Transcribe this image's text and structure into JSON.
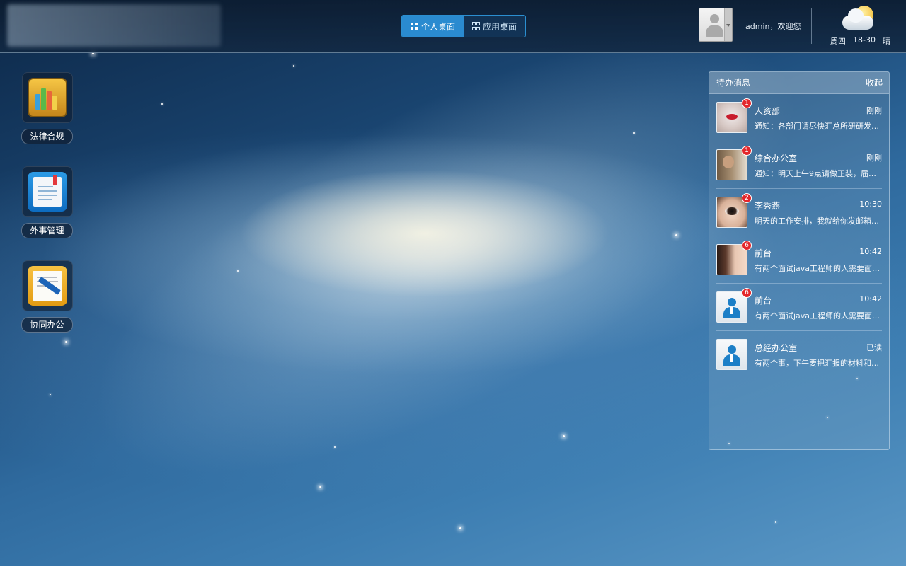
{
  "topbar": {
    "desk_switch": [
      {
        "label": "个人桌面",
        "active": true,
        "icon": "grid-filled-icon"
      },
      {
        "label": "应用桌面",
        "active": false,
        "icon": "grid-outline-icon"
      }
    ],
    "welcome_text": "admin，欢迎您",
    "weather": {
      "day": "周四",
      "temp": "18-30",
      "condition": "晴",
      "icon": "sunny-cloud-icon"
    }
  },
  "desktop_icons": [
    {
      "label": "法律合规",
      "icon": "books-icon"
    },
    {
      "label": "外事管理",
      "icon": "document-icon"
    },
    {
      "label": "协同办公",
      "icon": "notepad-pen-icon"
    }
  ],
  "todo": {
    "title": "待办消息",
    "collapse_label": "收起",
    "items": [
      {
        "sender": "人资部",
        "time": "刚刚",
        "preview": "通知：各部门请尽快汇总所研研发…",
        "badge": "1"
      },
      {
        "sender": "综合办公室",
        "time": "刚刚",
        "preview": "通知：明天上午9点请做正装，届时…",
        "badge": "1"
      },
      {
        "sender": "李秀燕",
        "time": "10:30",
        "preview": "明天的工作安排，我就给你发邮箱…",
        "badge": "2"
      },
      {
        "sender": "前台",
        "time": "10:42",
        "preview": "有两个面试java工程师的人需要面…",
        "badge": "6"
      },
      {
        "sender": "前台",
        "time": "10:42",
        "preview": "有两个面试java工程师的人需要面…",
        "badge": "6"
      },
      {
        "sender": "总经办公室",
        "time": "已读",
        "preview": "有两个事，下午要把汇报的材料和…",
        "badge": ""
      }
    ]
  },
  "colors": {
    "accent": "#2a8bd0",
    "badge": "#e3272b"
  }
}
